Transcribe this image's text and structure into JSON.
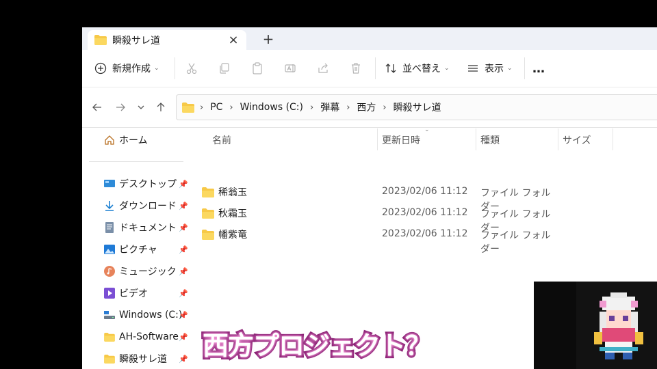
{
  "window": {
    "tab_title": "瞬殺サレ道",
    "tab_close": "×",
    "tab_new": "+"
  },
  "toolbar": {
    "new_label": "新規作成",
    "sort_label": "並べ替え",
    "view_label": "表示",
    "more_label": "…"
  },
  "address": {
    "crumbs": [
      "PC",
      "Windows (C:)",
      "弾幕",
      "西方",
      "瞬殺サレ道"
    ]
  },
  "sidebar": {
    "home": "ホーム",
    "items": [
      {
        "label": "デスクトップ",
        "icon": "desktop-icon"
      },
      {
        "label": "ダウンロード",
        "icon": "download-icon"
      },
      {
        "label": "ドキュメント",
        "icon": "document-icon"
      },
      {
        "label": "ピクチャ",
        "icon": "picture-icon"
      },
      {
        "label": "ミュージック",
        "icon": "music-icon"
      },
      {
        "label": "ビデオ",
        "icon": "video-icon"
      },
      {
        "label": "Windows (C:)",
        "icon": "drive-icon"
      },
      {
        "label": "AH-Software",
        "icon": "folder-icon"
      },
      {
        "label": "瞬殺サレ道",
        "icon": "folder-icon"
      }
    ]
  },
  "columns": {
    "name": "名前",
    "date": "更新日時",
    "type": "種類",
    "size": "サイズ"
  },
  "files": [
    {
      "name": "稀翁玉",
      "date": "2023/02/06 11:12",
      "type": "ファイル フォルダー"
    },
    {
      "name": "秋霜玉",
      "date": "2023/02/06 11:12",
      "type": "ファイル フォルダー"
    },
    {
      "name": "幡紫竜",
      "date": "2023/02/06 11:12",
      "type": "ファイル フォルダー"
    }
  ],
  "subtitle": "西方プロジェクト？",
  "colors": {
    "folder": "#f7c948",
    "accent": "#0067c0",
    "subtitle_stroke": "#8a1e72"
  }
}
